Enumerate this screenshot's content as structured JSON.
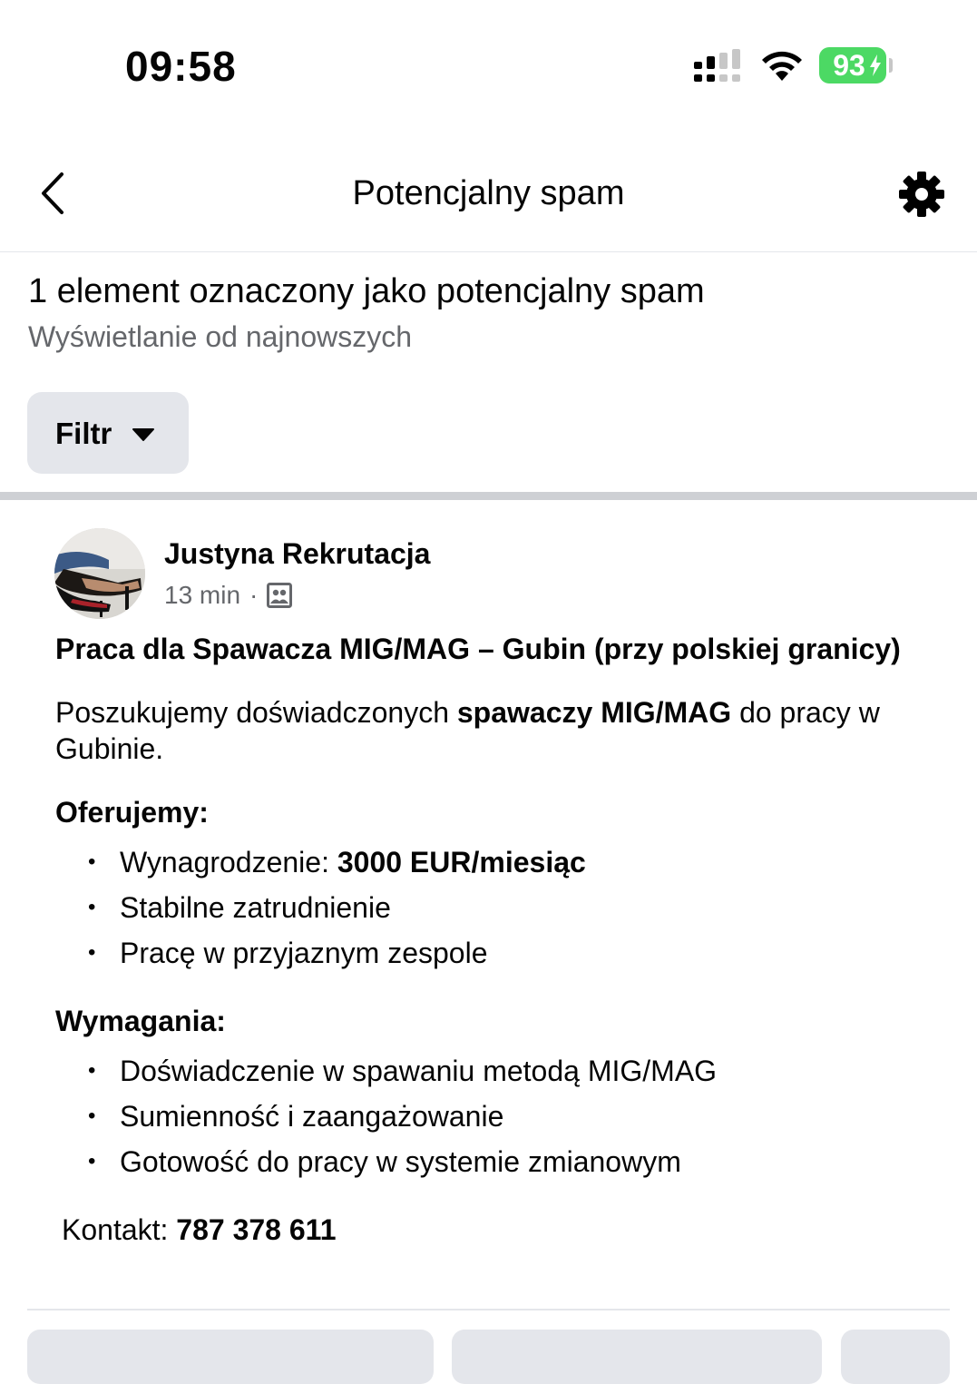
{
  "status_bar": {
    "time": "09:58",
    "battery": "93"
  },
  "nav": {
    "title": "Potencjalny spam",
    "back_icon": "chevron-left-icon",
    "settings_icon": "gear-icon"
  },
  "summary": {
    "title": "1 element oznaczony jako potencjalny spam",
    "subtitle": "Wyświetlanie od najnowszych"
  },
  "filter": {
    "label": "Filtr"
  },
  "post": {
    "author": "Justyna Rekrutacja",
    "time": "13 min",
    "separator": "·",
    "title": "Praca dla Spawacza MIG/MAG – Gubin (przy polskiej granicy)",
    "intro_pre": "Poszukujemy doświadczonych ",
    "intro_bold": "spawaczy MIG/MAG",
    "intro_post": " do pracy w Gubinie.",
    "offer_heading": "Oferujemy:",
    "offer_1_pre": "Wynagrodzenie: ",
    "offer_1_bold": "3000 EUR/miesiąc",
    "offer_2": "Stabilne zatrudnienie",
    "offer_3": "Pracę w przyjaznym zespole",
    "req_heading": "Wymagania:",
    "req_1": "Doświadczenie w spawaniu metodą MIG/MAG",
    "req_2": "Sumienność i zaangażowanie",
    "req_3": "Gotowość do pracy w systemie zmianowym",
    "contact_label": "Kontakt: ",
    "contact_phone": "787 378 611"
  }
}
